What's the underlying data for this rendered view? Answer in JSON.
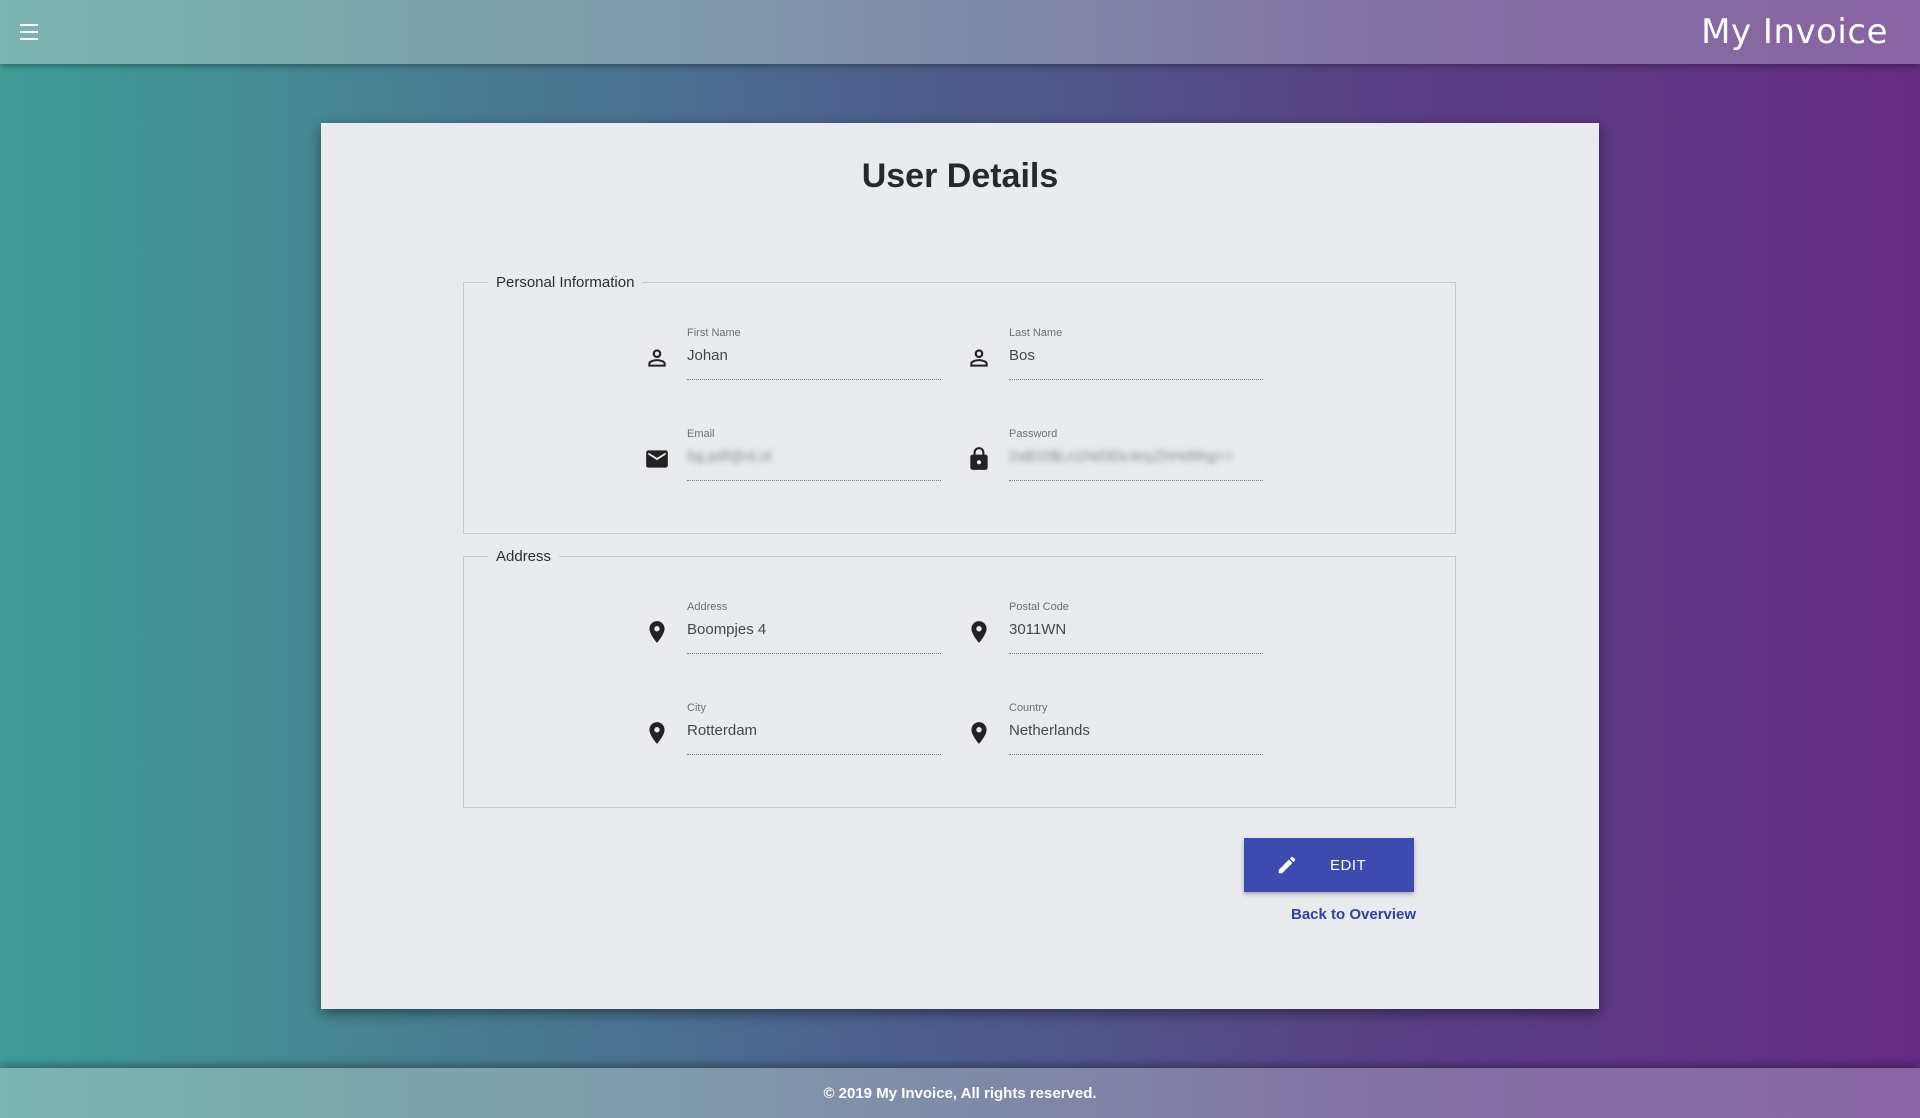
{
  "header": {
    "title": "My Invoice",
    "menu_icon": "hamburger-menu-icon"
  },
  "card": {
    "title": "User Details"
  },
  "personal": {
    "legend": "Personal Information",
    "first_name": {
      "label": "First Name",
      "value": "Johan",
      "icon": "person-icon"
    },
    "last_name": {
      "label": "Last Name",
      "value": "Bos",
      "icon": "person-icon"
    },
    "email": {
      "label": "Email",
      "value": "bg.pdf@nl.nl",
      "icon": "mail-icon"
    },
    "password": {
      "label": "Password",
      "value": "2a$10$Ln1Nd3Dc4nyZhHd9hg==",
      "icon": "lock-icon"
    }
  },
  "address": {
    "legend": "Address",
    "street": {
      "label": "Address",
      "value": "Boompjes 4",
      "icon": "location-pin-icon"
    },
    "postal_code": {
      "label": "Postal Code",
      "value": "3011WN",
      "icon": "location-pin-icon"
    },
    "city": {
      "label": "City",
      "value": "Rotterdam",
      "icon": "location-pin-icon"
    },
    "country": {
      "label": "Country",
      "value": "Netherlands",
      "icon": "location-pin-icon"
    }
  },
  "actions": {
    "edit_label": "EDIT",
    "edit_icon": "pencil-icon",
    "back_label": "Back to Overview"
  },
  "footer": {
    "text": "© 2019 My Invoice, All rights reserved."
  },
  "colors": {
    "primary_button": "#3d4ab0",
    "link": "#3340a0",
    "card_bg": "#e9ebef"
  }
}
